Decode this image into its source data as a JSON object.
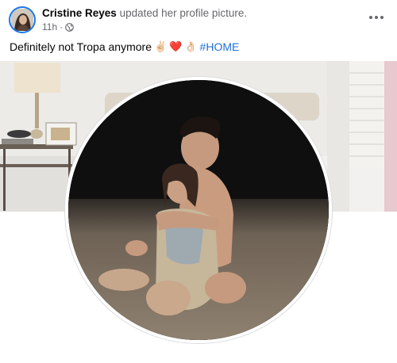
{
  "post": {
    "author": "Cristine Reyes",
    "action": "updated her profile picture.",
    "time": "11h",
    "separator": "·",
    "privacy_icon": "globe-icon",
    "more_icon": "more-horizontal-icon"
  },
  "caption": {
    "text": "Definitely not Tropa anymore",
    "emojis": [
      "✌🏻",
      "❤️",
      "👌🏻"
    ],
    "hashtag": "#HOME"
  },
  "colors": {
    "avatar_ring": "#1877f2",
    "hashtag": "#216fdb",
    "meta_text": "#65676b",
    "background": "#ffffff"
  }
}
